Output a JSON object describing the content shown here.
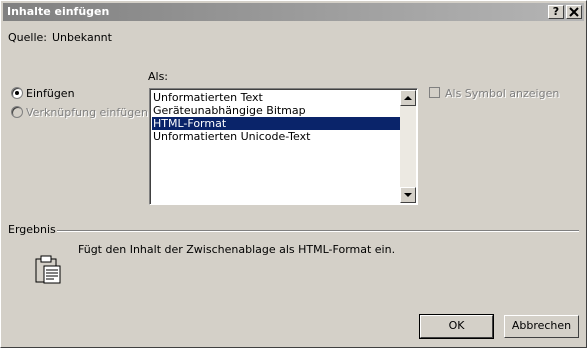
{
  "window": {
    "title": "Inhalte einfügen",
    "help_label": "?",
    "close_label": "X"
  },
  "source": {
    "label": "Quelle:",
    "value": "Unbekannt"
  },
  "options": {
    "paste_label": "Einfügen",
    "paste_link_label": "Verknüpfung einfügen:",
    "as_label": "Als:",
    "as_symbol_label": "Als Symbol anzeigen"
  },
  "formats": [
    "Unformatierten Text",
    "Geräteunabhängige Bitmap",
    "HTML-Format",
    "Unformatierten Unicode-Text"
  ],
  "selected_format": "HTML-Format",
  "result": {
    "label": "Ergebnis",
    "text": "Fügt den Inhalt der Zwischenablage als HTML-Format ein."
  },
  "buttons": {
    "ok": "OK",
    "cancel": "Abbrechen"
  },
  "colors": {
    "selection": "#0a246a",
    "face": "#d4d0c8"
  },
  "icons": {
    "result": "clipboard-icon",
    "scroll_up": "arrow-up-icon",
    "scroll_down": "arrow-down-icon"
  }
}
